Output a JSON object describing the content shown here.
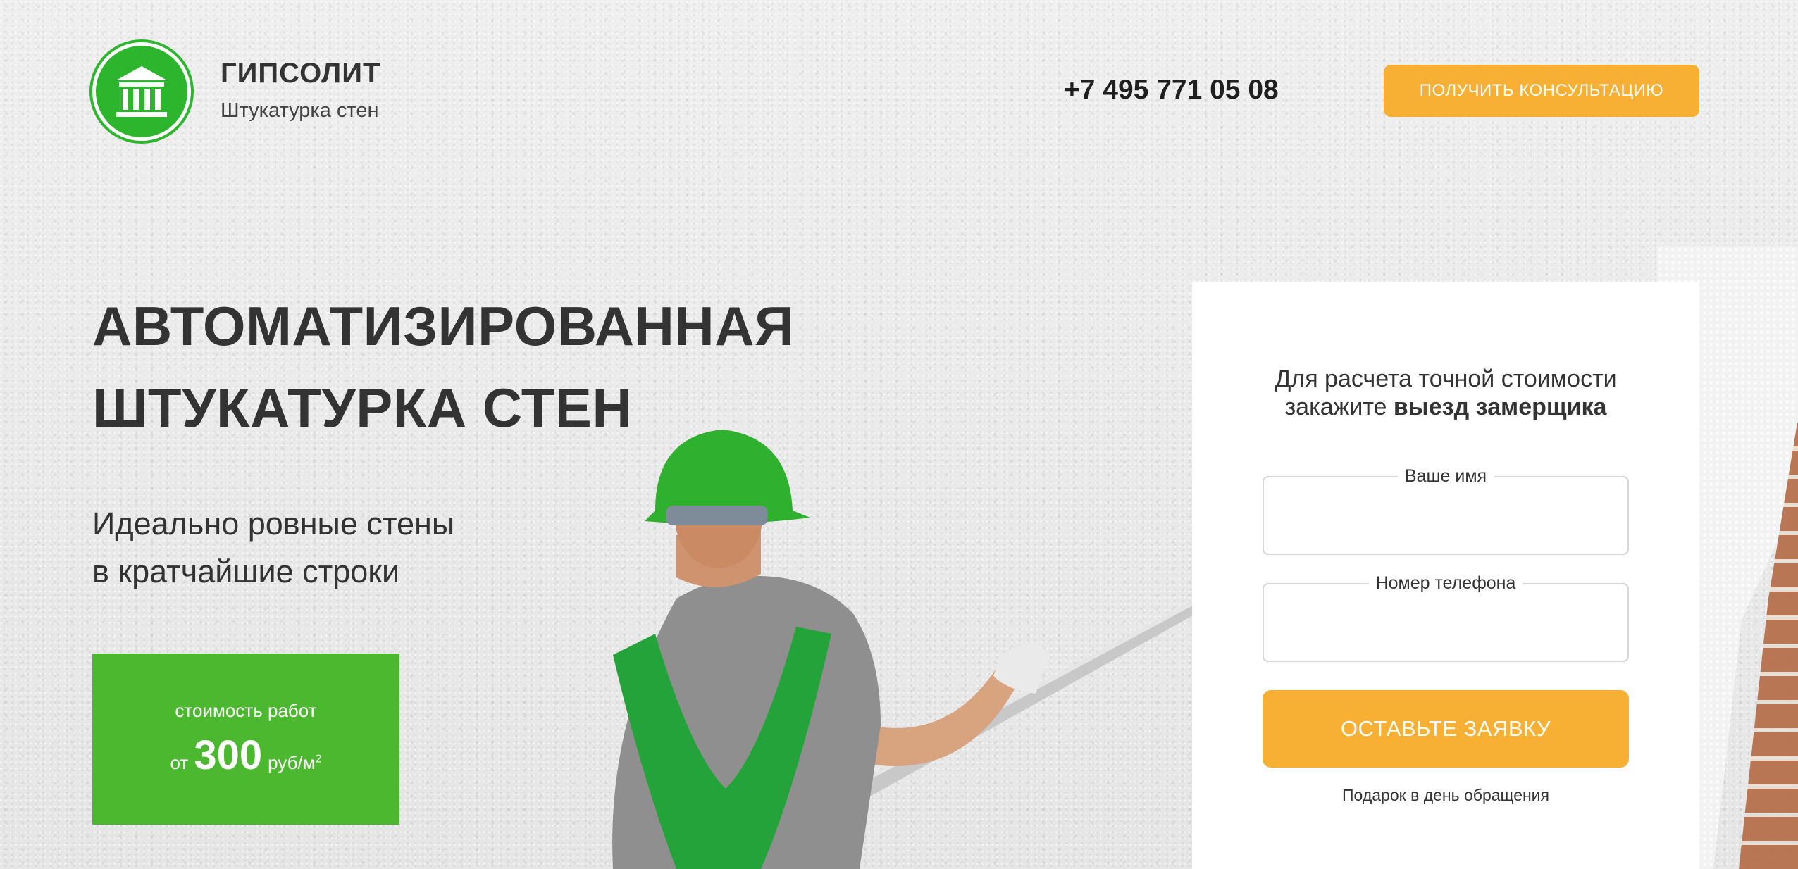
{
  "brand": {
    "name": "ГИПСОЛИТ",
    "subtitle": "Штукатурка стен",
    "logo_icon": "building-columns-icon",
    "logo_color": "#2eb52e"
  },
  "header": {
    "phone": "+7 495 771 05 08",
    "consult_button": "ПОЛУЧИТЬ КОНСУЛЬТАЦИЮ"
  },
  "hero": {
    "headline_line1": "АВТОМАТИЗИРОВАННАЯ",
    "headline_line2": "ШТУКАТУРКА СТЕН",
    "sub_line1": "Идеально ровные стены",
    "sub_line2": "в кратчайшие строки",
    "price": {
      "label": "стоимость работ",
      "from": "от",
      "value": "300",
      "unit": "руб/м",
      "unit_sup": "2",
      "box_color": "#4cb830"
    }
  },
  "form": {
    "title_line1": "Для расчета точной стоимости",
    "title_line2_plain": "закажите ",
    "title_line2_bold": "выезд замерщика",
    "name_label": "Ваше имя",
    "name_value": "",
    "phone_label": "Номер телефона",
    "phone_value": "",
    "submit": "ОСТАВЬТЕ ЗАЯВКУ",
    "note": "Подарок в день обращения",
    "accent_color": "#f7b033"
  }
}
